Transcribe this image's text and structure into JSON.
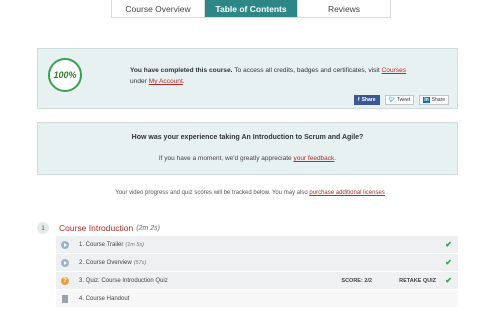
{
  "tabs": [
    {
      "label": "Course Overview"
    },
    {
      "label": "Table of Contents"
    },
    {
      "label": "Reviews"
    }
  ],
  "completion": {
    "badge": "100%",
    "headline": "You have completed this course.",
    "text_1": " To access all credits, badges and certificates, visit ",
    "link_courses": "Courses",
    "text_2": "under ",
    "link_account": "My Account",
    "text_3": ".",
    "share": {
      "facebook": "Share",
      "twitter": "Tweet",
      "linkedin": "Share"
    }
  },
  "feedback": {
    "question": "How was your experience taking An Introduction to Scrum and Agile?",
    "text": "If you have a moment, we'd greatly appreciate ",
    "link": "your feedback",
    "end": "."
  },
  "progress_note": {
    "text": "Your video progress and quiz scores will be tracked below. You may also ",
    "link": "purchase additional licenses"
  },
  "section": {
    "number": "1",
    "title": "Course Introduction",
    "duration": "(2m 2s)",
    "lessons": [
      {
        "label": "1. Course Trailer",
        "duration": "(1m 5s)",
        "type": "video",
        "completed": true
      },
      {
        "label": "2. Course Overview",
        "duration": "(57s)",
        "type": "video",
        "completed": true
      },
      {
        "label": "3. Quiz: Course Introduction Quiz",
        "duration": "",
        "type": "quiz",
        "score": "SCORE: 2/2",
        "retake": "RETAKE QUIZ",
        "completed": true
      },
      {
        "label": "4. Course Handout",
        "duration": "",
        "type": "document",
        "completed": false
      }
    ]
  },
  "icons": {
    "video": "play-circle-icon",
    "quiz": "question-circle-icon",
    "document": "document-icon",
    "check": "check-icon"
  },
  "colors": {
    "accent": "#2d8786",
    "link": "#b52a2a",
    "success": "#36a153",
    "panel": "#e8f1f1"
  }
}
